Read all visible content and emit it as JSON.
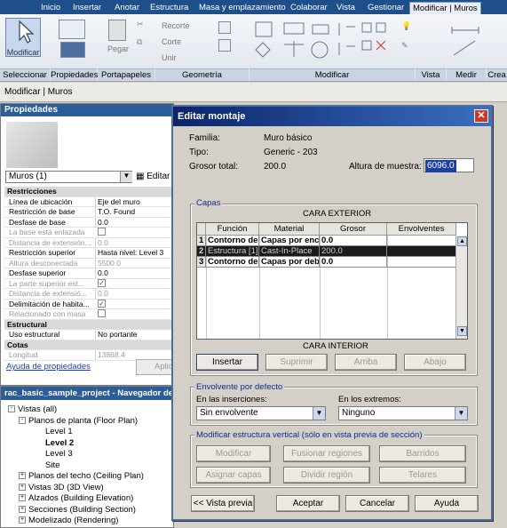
{
  "ribbon": {
    "tabs": [
      "Inicio",
      "Insertar",
      "Anotar",
      "Estructura",
      "Masa y emplazamiento",
      "Colaborar",
      "Vista",
      "Gestionar",
      "Modificar | Muros"
    ],
    "active_tab": "Modificar | Muros",
    "modify_button": "Modificar",
    "paste_button": "Pegar",
    "cope_button": "Recorte",
    "cut_button": "Corte",
    "join_button": "Unir",
    "panels": [
      "Seleccionar",
      "Propiedades",
      "Portapapeles",
      "Geometría",
      "Modificar",
      "Vista",
      "Medir",
      "Crea"
    ]
  },
  "context_bar": "Modificar | Muros",
  "properties": {
    "title": "Propiedades",
    "type_selector": "Muros (1)",
    "edit_type": "Editar",
    "rows": [
      {
        "k": "Restricciones",
        "v": "",
        "kind": "sec"
      },
      {
        "k": "Línea de ubicación",
        "v": "Eje del muro",
        "kind": "normal"
      },
      {
        "k": "Restricción de base",
        "v": "T.O. Found",
        "kind": "normal"
      },
      {
        "k": "Desfase de base",
        "v": "0.0",
        "kind": "normal"
      },
      {
        "k": "La base está enlazada",
        "v": "",
        "kind": "grey",
        "cb": "off"
      },
      {
        "k": "Distancia de extensión...",
        "v": "0.0",
        "kind": "grey"
      },
      {
        "k": "Restricción superior",
        "v": "Hasta nivel: Level 3",
        "kind": "normal"
      },
      {
        "k": "Altura desconectada",
        "v": "5500.0",
        "kind": "grey"
      },
      {
        "k": "Desfase superior",
        "v": "0.0",
        "kind": "normal"
      },
      {
        "k": "La parte superior est...",
        "v": "",
        "kind": "grey",
        "cb": "on"
      },
      {
        "k": "Distancia de extensió...",
        "v": "0.0",
        "kind": "grey"
      },
      {
        "k": "Delimitación de habita...",
        "v": "",
        "kind": "normal",
        "cb": "on"
      },
      {
        "k": "Relacionado con masa",
        "v": "",
        "kind": "grey",
        "cb": "off"
      },
      {
        "k": "Estructural",
        "v": "",
        "kind": "sec"
      },
      {
        "k": "Uso estructural",
        "v": "No portante",
        "kind": "normal"
      },
      {
        "k": "Cotas",
        "v": "",
        "kind": "sec"
      },
      {
        "k": "Longitud",
        "v": "13868.4",
        "kind": "grey"
      }
    ],
    "help_link": "Ayuda de propiedades",
    "apply_button": "Aplicar"
  },
  "browser": {
    "title": "rac_basic_sample_project - Navegador de proyectos",
    "nodes": [
      {
        "label": "Vistas (all)",
        "level": 0,
        "exp": "-"
      },
      {
        "label": "Planos de planta (Floor Plan)",
        "level": 1,
        "exp": "-"
      },
      {
        "label": "Level 1",
        "level": 2,
        "exp": ""
      },
      {
        "label": "Level 2",
        "level": 2,
        "exp": "",
        "bold": true
      },
      {
        "label": "Level 3",
        "level": 2,
        "exp": ""
      },
      {
        "label": "Site",
        "level": 2,
        "exp": ""
      },
      {
        "label": "Planos del techo (Ceiling Plan)",
        "level": 1,
        "exp": "+"
      },
      {
        "label": "Vistas 3D (3D View)",
        "level": 1,
        "exp": "+"
      },
      {
        "label": "Alzados (Building Elevation)",
        "level": 1,
        "exp": "+"
      },
      {
        "label": "Secciones (Building Section)",
        "level": 1,
        "exp": "+"
      },
      {
        "label": "Modelizado (Rendering)",
        "level": 1,
        "exp": "+"
      }
    ]
  },
  "dialog": {
    "title": "Editar montaje",
    "family_label": "Familia:",
    "family_value": "Muro básico",
    "type_label": "Tipo:",
    "type_value": "Generic - 203",
    "thickness_label": "Grosor total:",
    "thickness_value": "200.0",
    "sample_height_label": "Altura de muestra:",
    "sample_height_value": "6096.0",
    "layers_group": "Capas",
    "exterior_side": "CARA EXTERIOR",
    "interior_side": "CARA INTERIOR",
    "columns": [
      "Función",
      "Material",
      "Grosor",
      "Envolventes"
    ],
    "layers": [
      {
        "n": "1",
        "func": "Contorno del n",
        "mat": "Capas por enci",
        "thick": "0.0",
        "style": "bold"
      },
      {
        "n": "2",
        "func": "Estructura [1]",
        "mat": "Cast-In-Place",
        "thick": "200.0",
        "style": "sel"
      },
      {
        "n": "3",
        "func": "Contorno del n",
        "mat": "Capas por deb",
        "thick": "0.0",
        "style": "bold"
      }
    ],
    "insert_button": "Insertar",
    "delete_button": "Suprimir",
    "up_button": "Arriba",
    "down_button": "Abajo",
    "default_wrap_group": "Envolvente por defecto",
    "at_inserts_label": "En las inserciones:",
    "at_inserts_value": "Sin envolvente",
    "at_ends_label": "En los extremos:",
    "at_ends_value": "Ninguno",
    "vertical_group": "Modificar estructura vertical (sólo en vista previa de sección)",
    "modify_button": "Modificar",
    "merge_button": "Fusionar regiones",
    "sweeps_button": "Barridos",
    "assign_button": "Asignar capas",
    "split_button": "Dividir región",
    "reveals_button": "Telares",
    "preview_button": "<< Vista previa",
    "ok_button": "Aceptar",
    "cancel_button": "Cancelar",
    "help_button": "Ayuda"
  }
}
